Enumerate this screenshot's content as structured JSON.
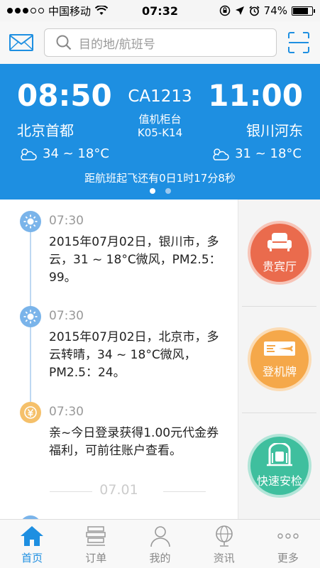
{
  "status_bar": {
    "carrier": "中国移动",
    "time": "07:32",
    "battery": "74%",
    "battery_level": 0.74
  },
  "search": {
    "placeholder": "目的地/航班号"
  },
  "flight_card": {
    "departure_time": "08:50",
    "arrival_time": "11:00",
    "flight_number": "CA1213",
    "counter_label": "值机柜台",
    "counter_value": "K05-K14",
    "departure_city": "北京首都",
    "arrival_city": "银川河东",
    "departure_weather": "34 ~ 18°C",
    "arrival_weather": "31 ~ 18°C",
    "countdown": "距航班起飞还有0日1时17分8秒",
    "pages": 2,
    "active_page": 1
  },
  "timeline": {
    "items": [
      {
        "icon": "sun-icon",
        "time": "07:30",
        "text": "2015年07月02日，银川市，多云，31 ~ 18°C微风，PM2.5：99。"
      },
      {
        "icon": "sun-icon",
        "time": "07:30",
        "text": "2015年07月02日，北京市，多云转晴，34 ~ 18°C微风，PM2.5：24。"
      },
      {
        "icon": "coin-icon",
        "time": "07:30",
        "text": "亲~今日登录获得1.00元代金券福利，可前往账户查看。"
      }
    ],
    "date_separator": "07.01"
  },
  "side_actions": [
    {
      "label": "贵宾厅",
      "icon": "sofa-icon",
      "color": "#ea6b4d"
    },
    {
      "label": "登机牌",
      "icon": "boarding-pass-icon",
      "color": "#f5a84a"
    },
    {
      "label": "快速安检",
      "icon": "security-gate-icon",
      "color": "#3fbf9e"
    }
  ],
  "tabs": [
    {
      "label": "首页",
      "icon": "home-icon",
      "active": true
    },
    {
      "label": "订单",
      "icon": "orders-icon",
      "active": false
    },
    {
      "label": "我的",
      "icon": "profile-icon",
      "active": false
    },
    {
      "label": "资讯",
      "icon": "globe-icon",
      "active": false
    },
    {
      "label": "更多",
      "icon": "more-icon",
      "active": false
    }
  ],
  "colors": {
    "accent": "#1e8fe1",
    "timeline_line": "#bdd8f2",
    "sun_icon": "#7ab4ea",
    "coin_icon": "#f5c06a"
  }
}
